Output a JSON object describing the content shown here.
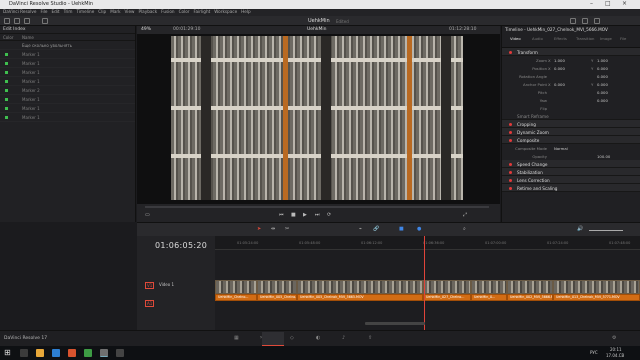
{
  "window": {
    "title": "DaVinci Resolve Studio - UehkMin"
  },
  "menu": [
    "DaVinci Resolve",
    "File",
    "Edit",
    "Trim",
    "Timeline",
    "Clip",
    "Mark",
    "View",
    "Playback",
    "Fusion",
    "Color",
    "Fairlight",
    "Workspace",
    "Help"
  ],
  "project": {
    "name": "UehkMin",
    "status": "Edited"
  },
  "edit_index": {
    "title": "Edit Index",
    "col_color": "Color",
    "col_name": "Name",
    "rows": [
      "Еще сколько увольнять",
      "Marker 1",
      "Marker 1",
      "Marker 1",
      "Marker 1",
      "Marker 2",
      "Marker 1",
      "Marker 1",
      "Marker 1"
    ]
  },
  "viewer": {
    "zoom": "49%",
    "timecode_left": "00:01:29:10",
    "timeline_name": "UehkMin",
    "timecode_right": "01:12:28:10"
  },
  "inspector": {
    "title": "Timeline - UehkMin_027_Chelnok_MVI_5666.MOV",
    "tabs": [
      "Video",
      "Audio",
      "Effects",
      "Transition",
      "Image",
      "File"
    ],
    "sections": {
      "transform": "Transform",
      "smart_reframe": "Smart Reframe",
      "cropping": "Cropping",
      "dynamic_zoom": "Dynamic Zoom",
      "composite": "Composite",
      "speed_change": "Speed Change",
      "stabilization": "Stabilization",
      "lens_correction": "Lens Correction",
      "retime_scaling": "Retime and Scaling"
    },
    "props": {
      "zoom": {
        "label": "Zoom",
        "x_axis": "X",
        "x": "1.000",
        "y_axis": "Y",
        "y": "1.000"
      },
      "position": {
        "label": "Position",
        "x_axis": "X",
        "x": "0.000",
        "y_axis": "Y",
        "y": "0.000"
      },
      "rotation": {
        "label": "Rotation Angle",
        "v": "0.000"
      },
      "anchor": {
        "label": "Anchor Point",
        "x_axis": "X",
        "x": "0.000",
        "y_axis": "Y",
        "y": "0.000"
      },
      "pitch": {
        "label": "Pitch",
        "v": "0.000"
      },
      "yaw": {
        "label": "Yaw",
        "v": "0.000"
      },
      "flip": {
        "label": "Flip"
      },
      "composite_mode": {
        "label": "Composite Mode",
        "v": "Normal"
      },
      "opacity": {
        "label": "Opacity",
        "v": "100.00"
      }
    }
  },
  "timeline": {
    "timecode": "01:06:05:20",
    "ruler": [
      "01:05:24:00",
      "01:05:48:00",
      "01:06:12:00",
      "01:06:36:00",
      "01:07:00:00",
      "01:07:24:00",
      "01:07:48:00"
    ],
    "video_track": {
      "id": "V1",
      "name": "Video 1"
    },
    "audio_track": {
      "id": "A1"
    },
    "clips": [
      "UehkMin_Chelno...",
      "UehkMin_005_Chelno...",
      "UehkMin_005_Chelnok_MVI_5665.MOV",
      "UehkMin_027_Chelno...",
      "UehkMin_0...",
      "UehkMin_002_MVI_5666.MOV",
      "UehkMin_013_Chelnok_MVI_5771.MOV"
    ]
  },
  "footer": {
    "app": "DaVinci Resolve 17"
  },
  "taskbar": {
    "lang": "РУС",
    "time": "20:11",
    "date": "17.04.CB"
  }
}
